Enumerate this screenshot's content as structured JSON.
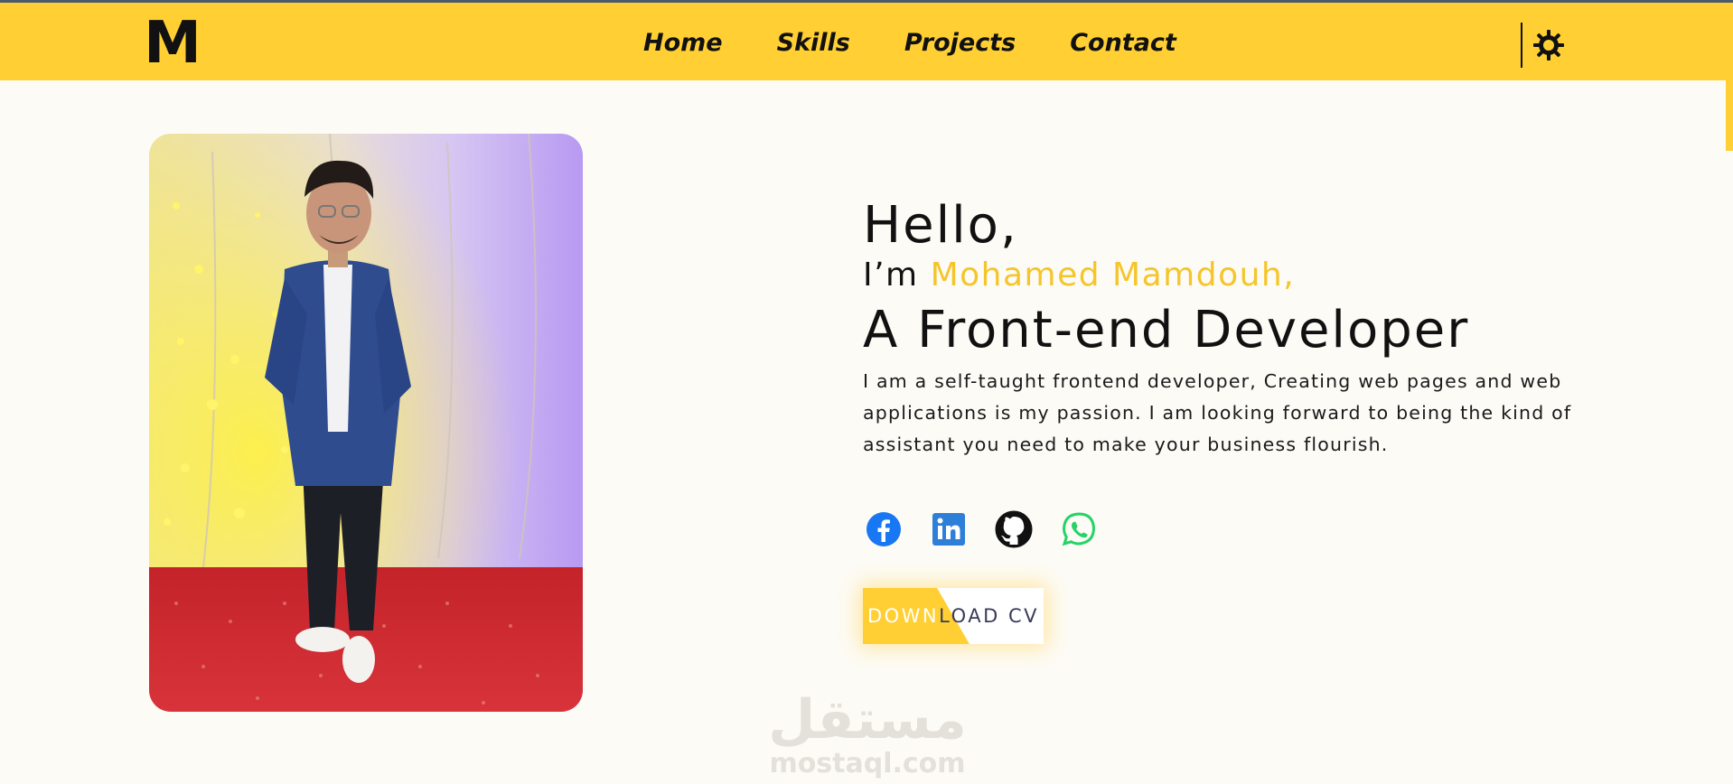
{
  "nav": {
    "logo": "M",
    "links": [
      "Home",
      "Skills",
      "Projects",
      "Contact"
    ]
  },
  "hero": {
    "greeting": "Hello,",
    "intro_prefix": "I’m ",
    "name": "Mohamed Mamdouh,",
    "role": "A Front-end Developer",
    "bio": "I am a self-taught frontend developer, Creating web pages and web applications is my passion. I am looking forward to being the kind of assistant you need to make your business flourish.",
    "socials": [
      "facebook-icon",
      "linkedin-icon",
      "github-icon",
      "whatsapp-icon"
    ],
    "cv_button_left": "DOWN",
    "cv_button_right": "LOAD CV"
  },
  "watermark": {
    "arabic": "مستقل",
    "latin": "mostaql.com"
  },
  "colors": {
    "accent": "#ffcf33",
    "name": "#f5c52b",
    "background": "#fdfbf6",
    "facebook": "#1877f2",
    "linkedin": "#0a66c2",
    "whatsapp": "#25d366"
  }
}
